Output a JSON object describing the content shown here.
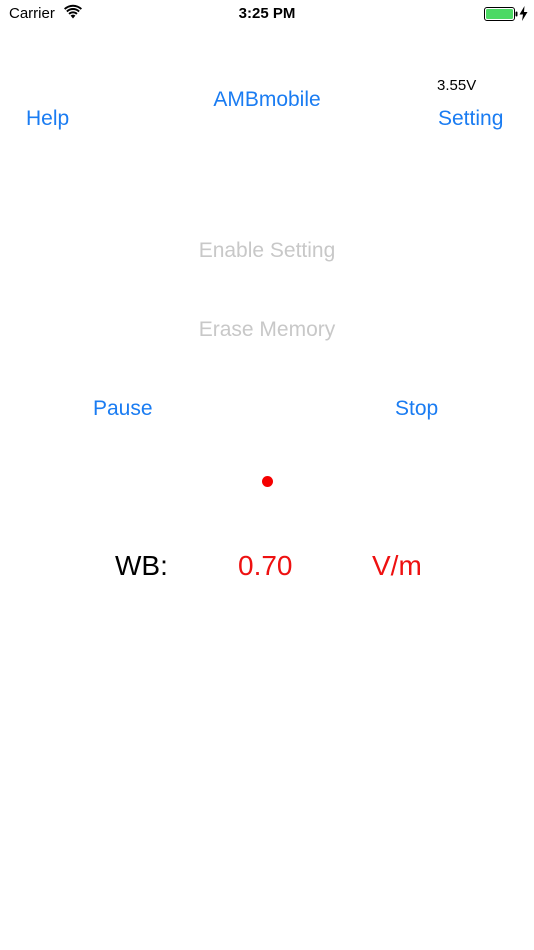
{
  "status_bar": {
    "carrier": "Carrier",
    "time": "3:25 PM",
    "battery_color": "#4cd964"
  },
  "header": {
    "help_label": "Help",
    "title": "AMBmobile",
    "voltage": "3.55V",
    "setting_label": "Setting"
  },
  "controls": {
    "enable_setting_label": "Enable Setting",
    "erase_memory_label": "Erase Memory",
    "pause_label": "Pause",
    "stop_label": "Stop"
  },
  "indicator": {
    "color": "#f50000"
  },
  "reading": {
    "label": "WB:",
    "value": "0.70",
    "unit": "V/m"
  },
  "colors": {
    "accent": "#1a7cf2",
    "disabled": "#c8c8c8",
    "alert": "#ee1111"
  }
}
